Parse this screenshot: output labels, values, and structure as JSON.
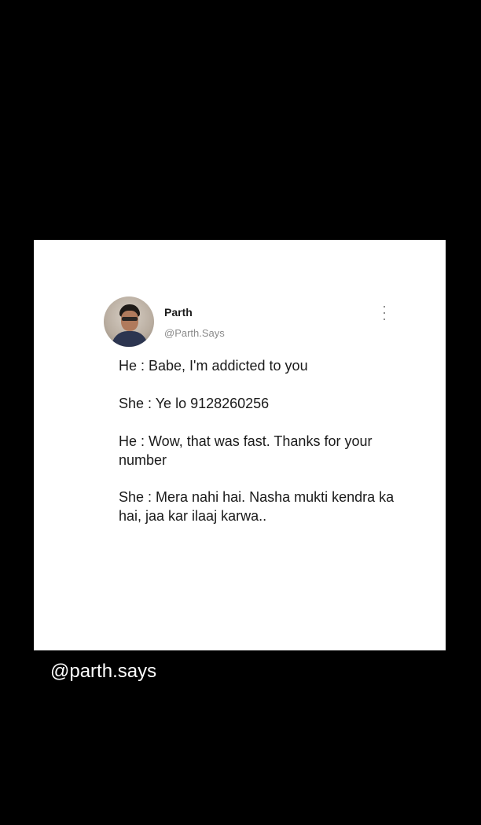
{
  "post": {
    "author_name": "Parth",
    "author_handle": "@Parth.Says",
    "lines": [
      "He : Babe, I'm addicted to you",
      "She : Ye lo 9128260256",
      "He : Wow, that was fast. Thanks for your number",
      "She : Mera nahi hai. Nasha mukti kendra ka hai, jaa kar ilaaj karwa.."
    ],
    "menu_icon": "more-vertical-icon"
  },
  "caption": "@parth.says",
  "colors": {
    "background": "#000000",
    "card": "#ffffff",
    "text": "#1a1a1a",
    "handle": "#8a8a8a"
  }
}
